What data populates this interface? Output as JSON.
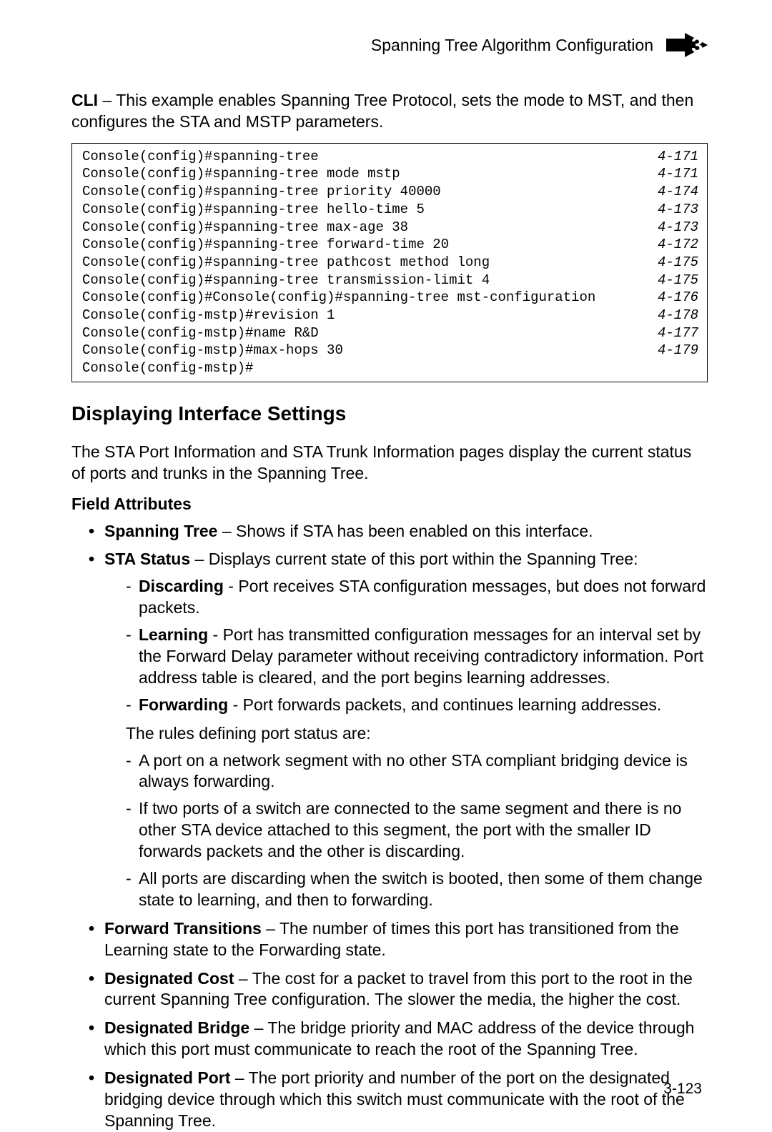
{
  "header": {
    "title": "Spanning Tree Algorithm Configuration",
    "chapter": "3"
  },
  "intro": {
    "label": "CLI",
    "text": " – This example enables Spanning Tree Protocol, sets the mode to MST, and then configures the STA and MSTP parameters."
  },
  "code": {
    "lines": [
      {
        "cmd": "Console(config)#spanning-tree",
        "ref": "4-171"
      },
      {
        "cmd": "Console(config)#spanning-tree mode mstp",
        "ref": "4-171"
      },
      {
        "cmd": "Console(config)#spanning-tree priority 40000",
        "ref": "4-174"
      },
      {
        "cmd": "Console(config)#spanning-tree hello-time 5",
        "ref": "4-173"
      },
      {
        "cmd": "Console(config)#spanning-tree max-age 38",
        "ref": "4-173"
      },
      {
        "cmd": "Console(config)#spanning-tree forward-time 20",
        "ref": "4-172"
      },
      {
        "cmd": "Console(config)#spanning-tree pathcost method long",
        "ref": "4-175"
      },
      {
        "cmd": "Console(config)#spanning-tree transmission-limit 4",
        "ref": "4-175"
      },
      {
        "cmd": "Console(config)#Console(config)#spanning-tree mst-configuration",
        "ref": "4-176"
      },
      {
        "cmd": "Console(config-mstp)#revision 1",
        "ref": "4-178"
      },
      {
        "cmd": "Console(config-mstp)#name R&D",
        "ref": "4-177"
      },
      {
        "cmd": "Console(config-mstp)#max-hops 30",
        "ref": "4-179"
      },
      {
        "cmd": "Console(config-mstp)#",
        "ref": ""
      }
    ]
  },
  "section": {
    "heading": "Displaying Interface Settings",
    "intro": "The STA Port Information and STA Trunk Information pages display the current status of ports and trunks in the Spanning Tree.",
    "field_attr": "Field Attributes"
  },
  "bullets": {
    "b1": {
      "term": "Spanning Tree",
      "text": " – Shows if STA has been enabled on this interface."
    },
    "b2": {
      "term": "STA Status",
      "text": " – Displays current state of this port within the Spanning Tree:",
      "sub": {
        "s1": {
          "term": "Discarding",
          "text": " - Port receives STA configuration messages, but does not forward packets."
        },
        "s2": {
          "term": "Learning",
          "text": " - Port has transmitted configuration messages for an interval set by the Forward Delay parameter without receiving contradictory information. Port address table is cleared, and the port begins learning addresses."
        },
        "s3": {
          "term": "Forwarding",
          "text": " - Port forwards packets, and continues learning addresses."
        }
      },
      "rules_intro": "The rules defining port status are:",
      "rules": {
        "r1": "A port on a network segment with no other STA compliant bridging device is always forwarding.",
        "r2": "If two ports of a switch are connected to the same segment and there is no other STA device attached to this segment, the port with the smaller ID forwards packets and the other is discarding.",
        "r3": "All ports are discarding when the switch is booted, then some of them change state to learning, and then to forwarding."
      }
    },
    "b3": {
      "term": "Forward Transitions",
      "text": " – The number of times this port has transitioned from the Learning state to the Forwarding state."
    },
    "b4": {
      "term": "Designated Cost",
      "text": " – The cost for a packet to travel from this port to the root in the current Spanning Tree configuration. The slower the media, the higher the cost."
    },
    "b5": {
      "term": "Designated Bridge",
      "text": " – The bridge priority and MAC address of the device through which this port must communicate to reach the root of the Spanning Tree."
    },
    "b6": {
      "term": "Designated Port",
      "text": " – The port priority and number of the port on the designated bridging device through which this switch must communicate with the root of the Spanning Tree."
    }
  },
  "page_number": "3-123"
}
